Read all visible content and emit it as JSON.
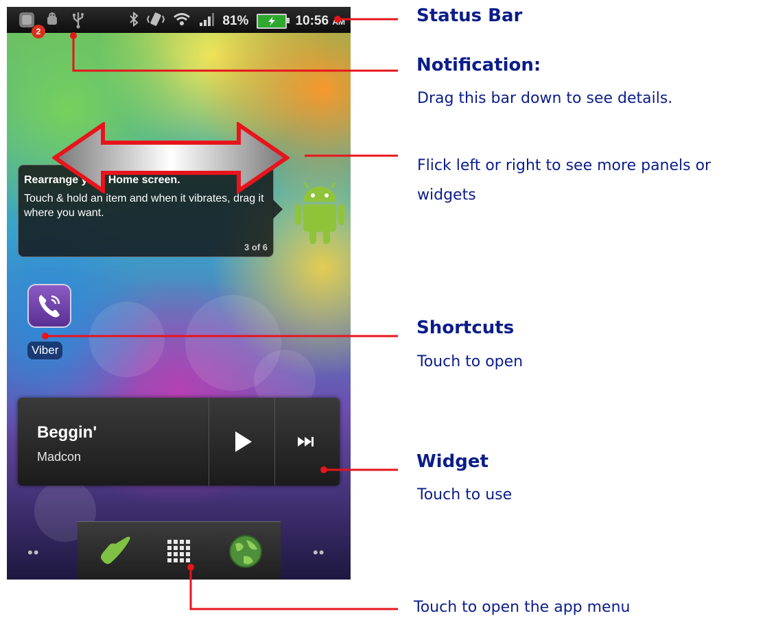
{
  "status_bar": {
    "notification_count": "2",
    "battery": "81%",
    "time": "10:56",
    "am_pm": "AM",
    "icons": [
      "notification-app-icon",
      "android-debug-icon",
      "usb-icon",
      "bluetooth-icon",
      "vibrate-icon",
      "wifi-icon",
      "signal-icon",
      "battery-charging-icon"
    ]
  },
  "tip": {
    "title": "Rearrange your Home screen.",
    "body": "Touch & hold an item and when it vibrates, drag it where you want.",
    "counter": "3 of 6"
  },
  "shortcut": {
    "label": "Viber",
    "icon": "viber-phone-icon"
  },
  "music_widget": {
    "title": "Beggin'",
    "artist": "Madcon",
    "controls": [
      "play-icon",
      "next-track-icon"
    ]
  },
  "dock": {
    "items": [
      "phone-icon",
      "app-menu-grid-icon",
      "browser-globe-icon"
    ]
  },
  "annotations": {
    "status_bar": {
      "title": "Status Bar"
    },
    "notification": {
      "title": "Notification:",
      "text": "Drag this bar down to see details."
    },
    "flick": {
      "text_line1": "Flick left or right to see more panels or",
      "text_line2": "widgets"
    },
    "shortcuts": {
      "title": "Shortcuts",
      "text": "Touch to open"
    },
    "widget": {
      "title": "Widget",
      "text": "Touch to use"
    },
    "app_menu": {
      "text": "Touch to open the app menu"
    }
  },
  "colors": {
    "annotation_text": "#0b1d8a",
    "callout_line": "#e8141c"
  }
}
